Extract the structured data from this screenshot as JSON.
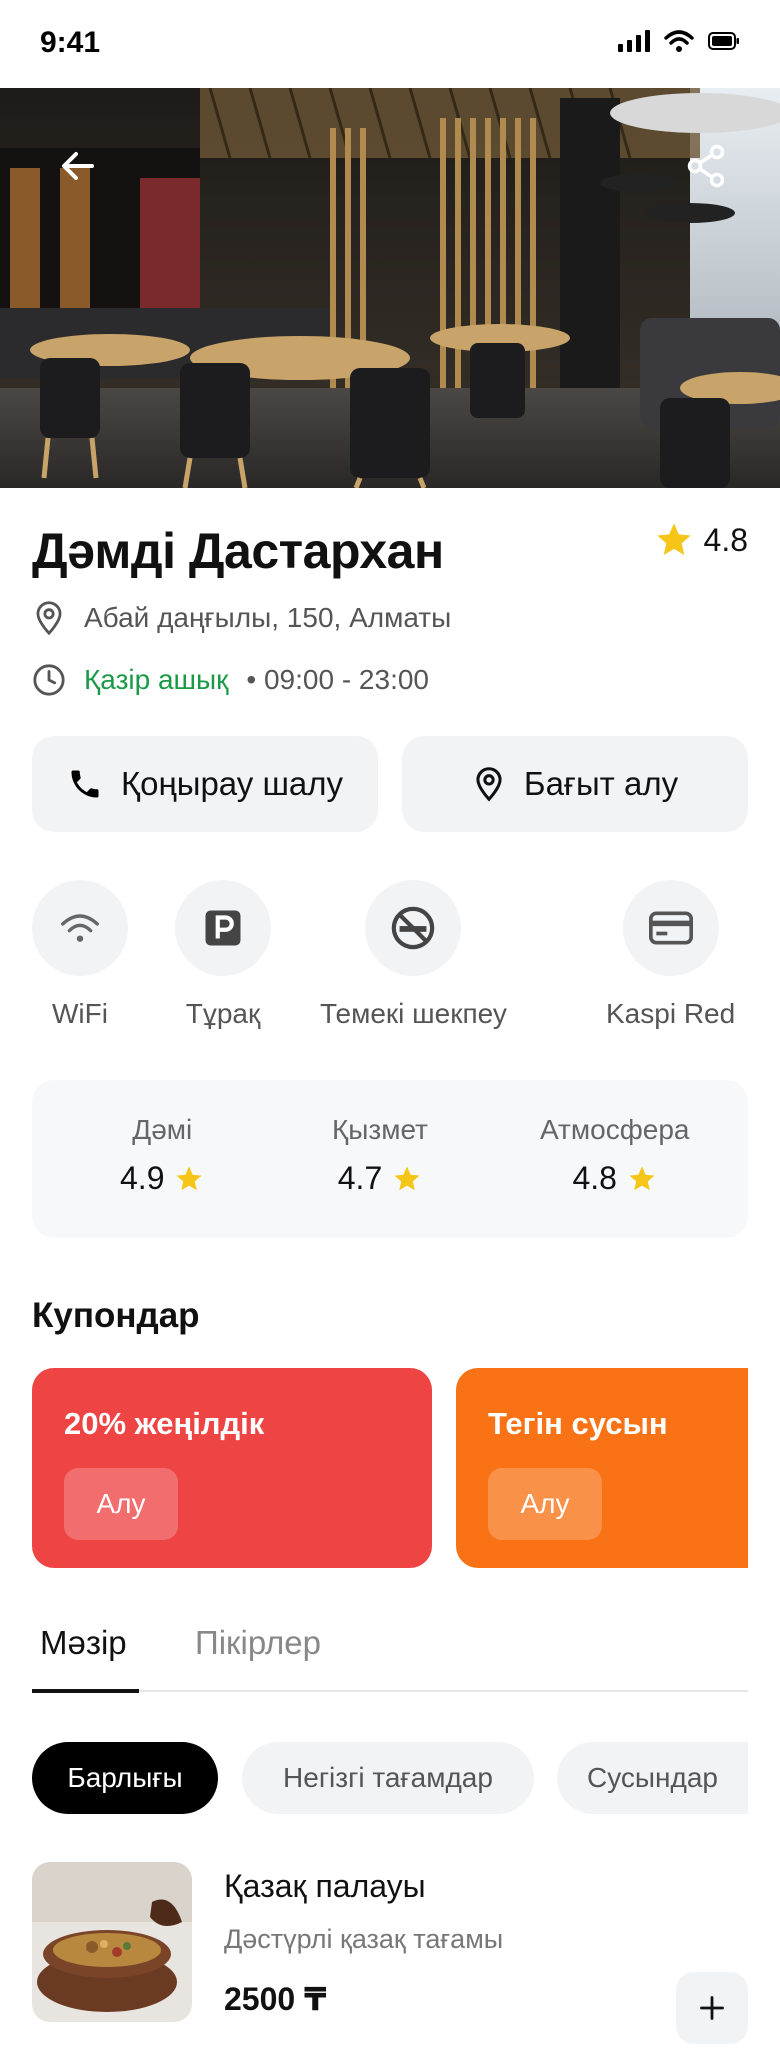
{
  "status_bar": {
    "time": "9:41"
  },
  "restaurant": {
    "name": "Дәмді Дастархан",
    "rating": "4.8",
    "address": "Абай даңғылы, 150, Алматы",
    "open_status": "Қазір ашық",
    "hours": "• 09:00 - 23:00"
  },
  "actions": {
    "call_label": "Қоңырау шалу",
    "directions_label": "Бағыт алу"
  },
  "amenities": [
    {
      "label": "WiFi",
      "icon": "wifi-icon"
    },
    {
      "label": "Тұрақ",
      "icon": "parking-icon"
    },
    {
      "label": "Темекі шекпеу",
      "icon": "no-smoking-icon"
    },
    {
      "label": "Kaspi Red",
      "icon": "card-icon"
    }
  ],
  "scores": [
    {
      "label": "Дәмі",
      "value": "4.9"
    },
    {
      "label": "Қызмет",
      "value": "4.7"
    },
    {
      "label": "Атмосфера",
      "value": "4.8"
    }
  ],
  "coupons": {
    "title": "Купондар",
    "items": [
      {
        "title": "20% жеңілдік",
        "button": "Алу",
        "color": "#ef4444"
      },
      {
        "title": "Тегін сусын",
        "button": "Алу",
        "color": "#f97316"
      }
    ]
  },
  "tabs": [
    {
      "label": "Мәзір",
      "active": true
    },
    {
      "label": "Пікірлер",
      "active": false
    }
  ],
  "categories": [
    {
      "label": "Барлығы",
      "active": true
    },
    {
      "label": "Негізгі тағамдар",
      "active": false
    },
    {
      "label": "Сусындар",
      "active": false
    }
  ],
  "menu": [
    {
      "name": "Қазақ палауы",
      "description": "Дәстүрлі қазақ тағамы",
      "price": "2500 ₸"
    }
  ],
  "colors": {
    "accent_open": "#1a9a47",
    "star": "#f5c518",
    "chip_active": "#000000",
    "surface": "#f2f3f5"
  }
}
